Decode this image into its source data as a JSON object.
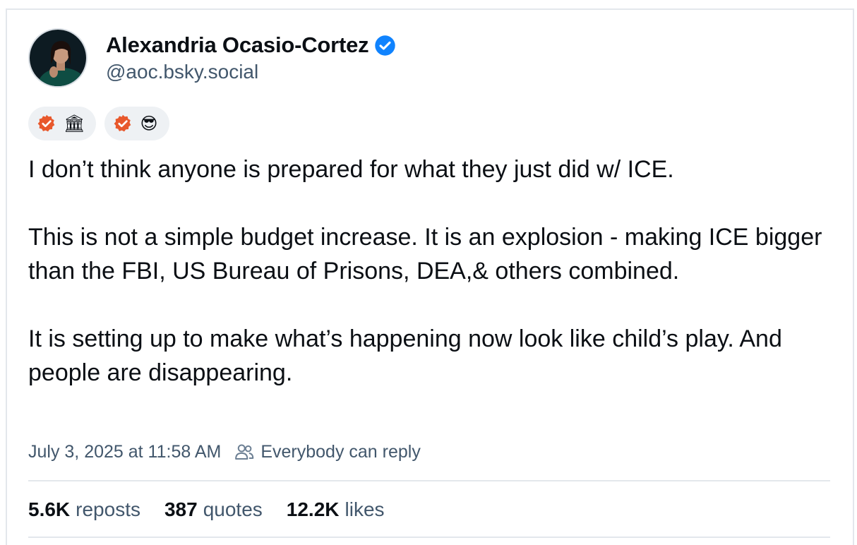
{
  "author": {
    "display_name": "Alexandria Ocasio-Cortez",
    "handle": "@aoc.bsky.social",
    "verified": true,
    "verified_color": "#1083fe"
  },
  "badges": [
    {
      "icon": "orange-check-icon",
      "emoji": "🏛"
    },
    {
      "icon": "orange-check-icon",
      "emoji": "😎"
    }
  ],
  "post": {
    "paragraphs": [
      "I don’t think anyone is prepared for what they just did w/ ICE.",
      "This is not a simple budget increase. It is an explosion - making ICE bigger than the FBI, US Bureau of Prisons, DEA,& others combined.",
      "It is setting up to make what’s happening now look like child’s play. And people are disappearing."
    ],
    "timestamp": "July 3, 2025 at 11:58 AM",
    "reply_setting": "Everybody can reply"
  },
  "stats": {
    "reposts_count": "5.6K",
    "reposts_label": "reposts",
    "quotes_count": "387",
    "quotes_label": "quotes",
    "likes_count": "12.2K",
    "likes_label": "likes"
  },
  "colors": {
    "accent_check": "#e8582c",
    "text_primary": "#0b0f14",
    "text_secondary": "#42576c",
    "divider": "#e3e7ec"
  }
}
